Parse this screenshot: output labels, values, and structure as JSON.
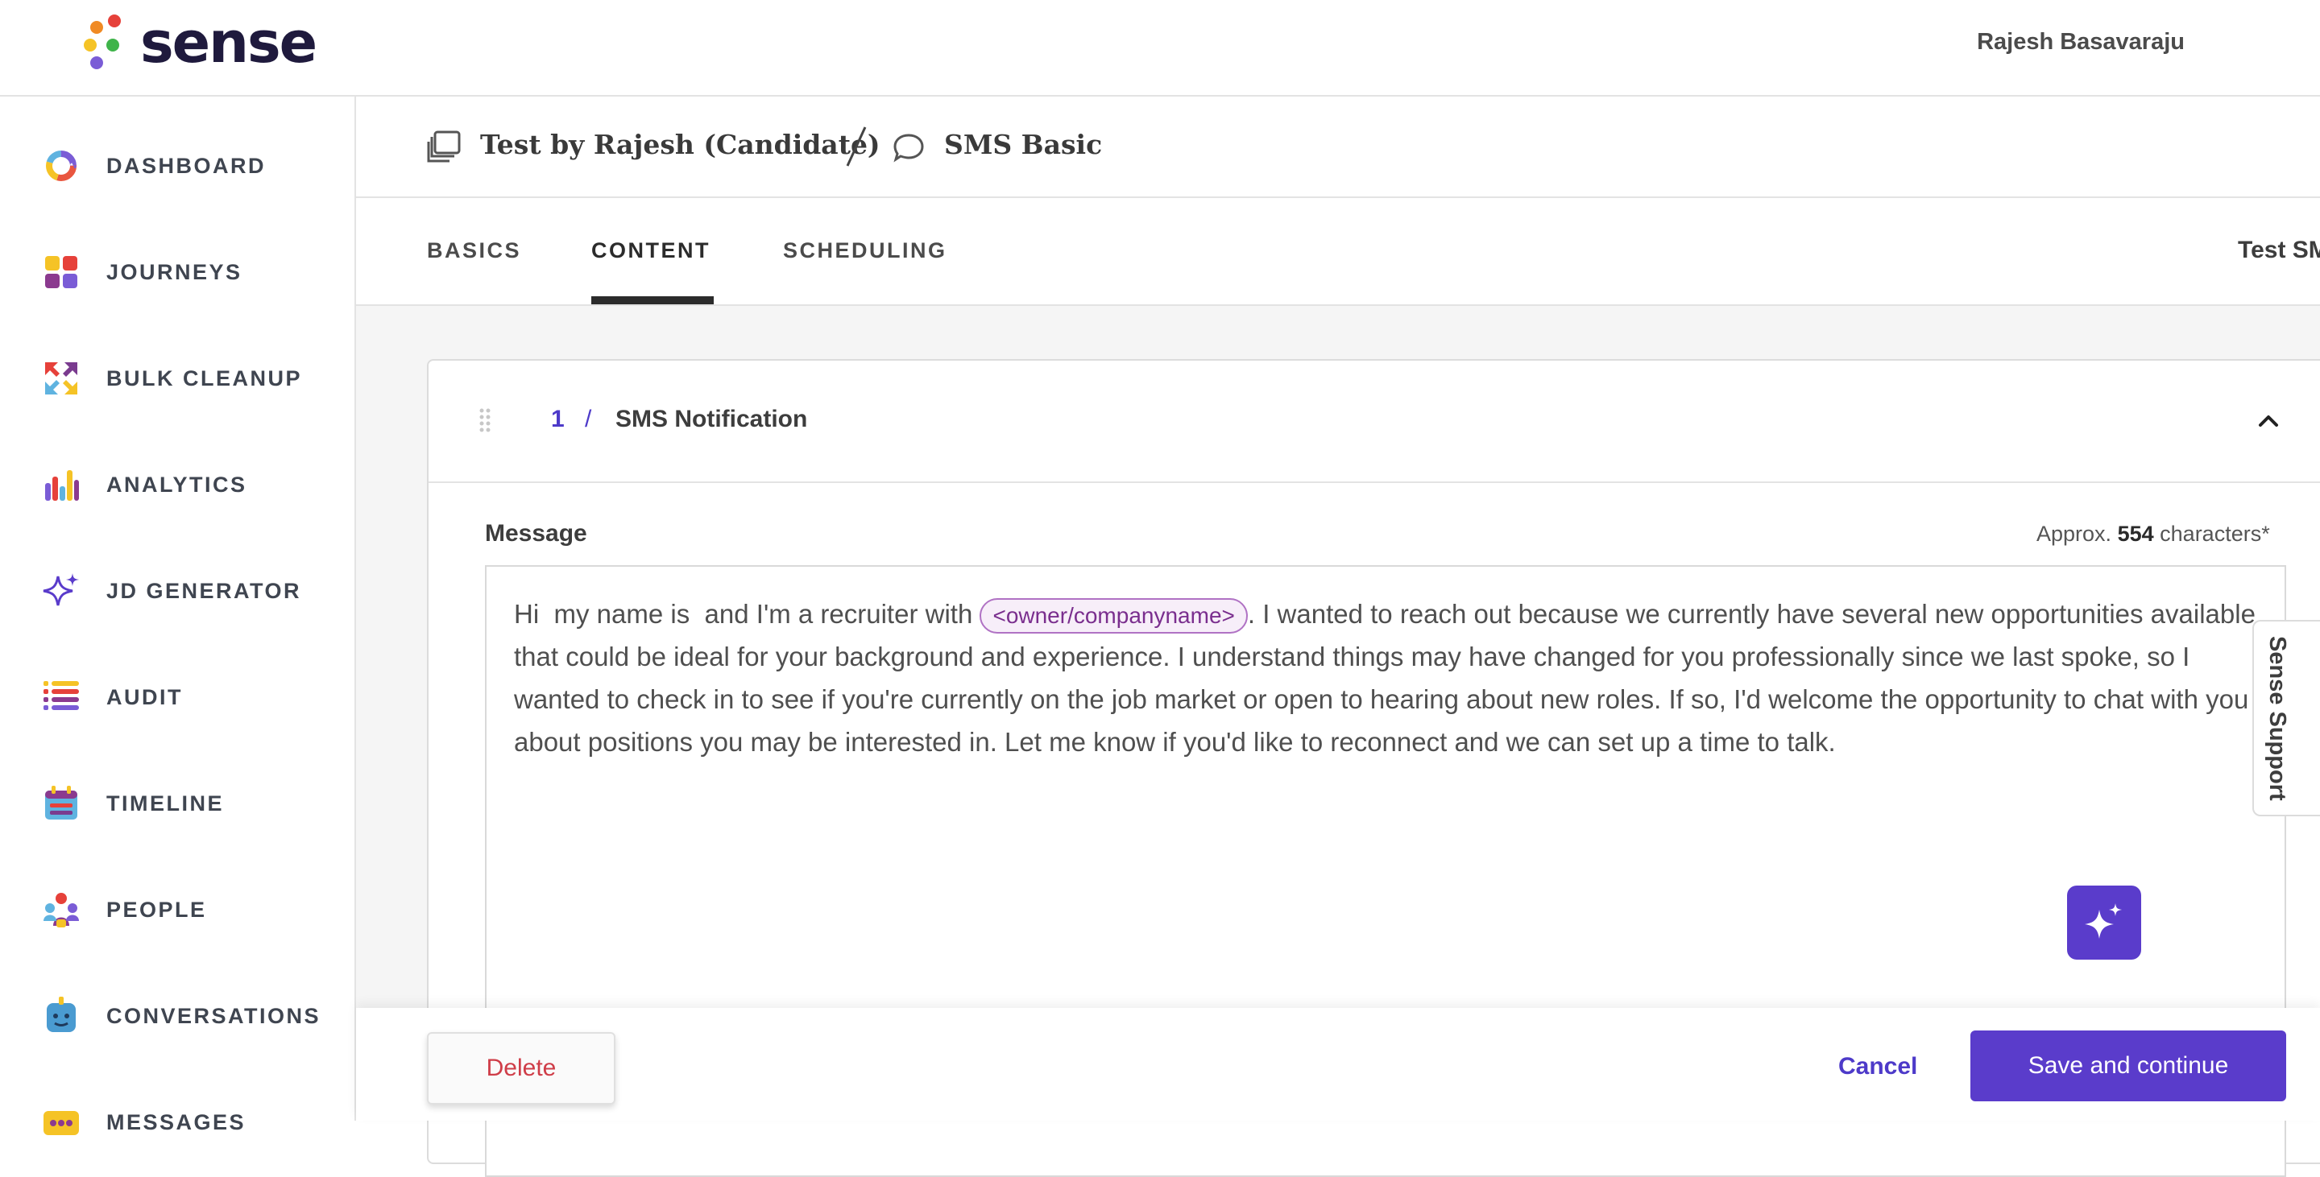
{
  "header": {
    "logo_text": "sense",
    "user_name": "Rajesh Basavaraju"
  },
  "sidebar": {
    "items": [
      {
        "label": "DASHBOARD",
        "icon": "dashboard-ring-icon"
      },
      {
        "label": "JOURNEYS",
        "icon": "journeys-grid-icon"
      },
      {
        "label": "BULK CLEANUP",
        "icon": "bulk-cleanup-arrows-icon"
      },
      {
        "label": "ANALYTICS",
        "icon": "analytics-bars-icon"
      },
      {
        "label": "JD GENERATOR",
        "icon": "sparkle-icon"
      },
      {
        "label": "AUDIT",
        "icon": "audit-list-icon"
      },
      {
        "label": "TIMELINE",
        "icon": "timeline-calendar-icon"
      },
      {
        "label": "PEOPLE",
        "icon": "people-icon"
      },
      {
        "label": "CONVERSATIONS",
        "icon": "bot-chat-icon"
      },
      {
        "label": "MESSAGES",
        "icon": "messages-icon"
      }
    ]
  },
  "breadcrumb": {
    "journey": "Test by Rajesh (Candidate)",
    "separator": "/",
    "message": "SMS Basic"
  },
  "tabs": [
    {
      "label": "BASICS",
      "active": false
    },
    {
      "label": "CONTENT",
      "active": true
    },
    {
      "label": "SCHEDULING",
      "active": false
    }
  ],
  "test_sms_label": "Test SMS",
  "card": {
    "step_number": "1",
    "step_separator": "/",
    "step_title": "SMS Notification",
    "message_label": "Message",
    "char_count_prefix": "Approx.",
    "char_count_value": "554",
    "char_count_suffix": "characters*",
    "message_before_token": "Hi  my name is  and I'm a recruiter with ",
    "message_token": "<owner/companyname>",
    "message_after_token": ". I wanted to reach out because we currently have several new opportunities available that could be ideal for your background and experience. I understand things may have changed for you professionally since we last spoke, so I wanted to check in to see if you're currently on the job market or open to hearing about new roles. If so, I'd welcome the opportunity to chat with you about positions you may be interested in. Let me know if you'd like to reconnect and we can set up a time to talk."
  },
  "support_tab_label": "Sense Support",
  "footer": {
    "delete_label": "Delete",
    "cancel_label": "Cancel",
    "save_label": "Save and continue"
  },
  "colors": {
    "accent": "#5a3ccb",
    "link": "#4d3ac9",
    "danger": "#cf3d48",
    "token_border": "#b072c4"
  }
}
